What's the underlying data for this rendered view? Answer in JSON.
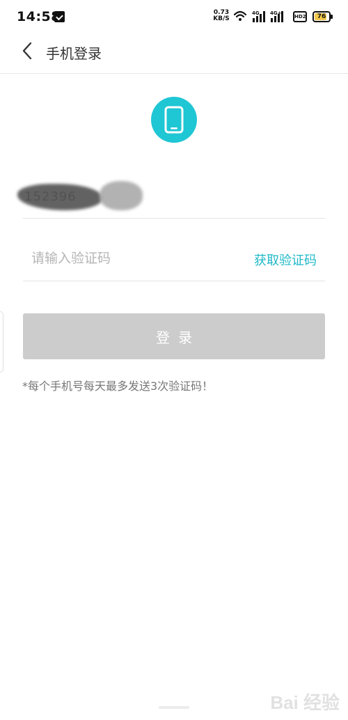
{
  "status_bar": {
    "time": "14:58",
    "net_speed_value": "0.73",
    "net_speed_unit": "KB/S",
    "network_1": "4G",
    "network_2": "4G+",
    "hd_label": "HD2",
    "battery_level": "76"
  },
  "header": {
    "title": "手机登录"
  },
  "form": {
    "phone_value": "152396",
    "code_placeholder": "请输入验证码",
    "get_code_label": "获取验证码",
    "login_label": "登录",
    "note": "*每个手机号每天最多发送3次验证码！"
  },
  "watermark": {
    "text": "Bai 经验"
  },
  "colors": {
    "accent": "#1fc6d4",
    "link": "#1fb8c8",
    "button_disabled": "#cccccc"
  }
}
